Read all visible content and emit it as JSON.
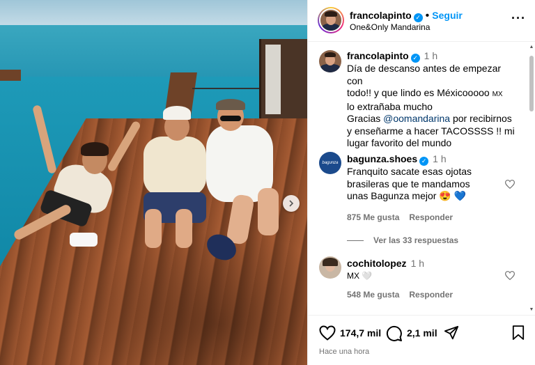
{
  "post": {
    "username": "francolapinto",
    "follow_label": "Seguir",
    "location": "One&Only Mandarina",
    "caption": {
      "username": "francolapinto",
      "time": "1 h",
      "line1": "Día de descanso antes de empezar con",
      "line2": "todo!! y que lindo es Méxicooooo",
      "line2_flag": "MX",
      "line3": "lo extrañaba mucho",
      "line4_prefix": "Gracias ",
      "line4_mention": "@oomandarina",
      "line4_suffix": " por recibirnos",
      "line5": "y enseñarme a hacer TACOSSSS !! mi",
      "line6": "lugar favorito del mundo"
    }
  },
  "comments": [
    {
      "username": "bagunza.shoes",
      "time": "1 h",
      "avatar_text": "bagunza",
      "line1": "Franquito sacate esas ojotas",
      "line2": "brasileras que te mandamos",
      "line3": "unas Bagunza mejor",
      "emoji": "😍 💙",
      "likes": "875 Me gusta",
      "reply": "Responder",
      "view_replies": "Ver las 33 respuestas"
    },
    {
      "username": "cochitolopez",
      "time": "1 h",
      "line1": "MX 🤍",
      "likes": "548 Me gusta",
      "reply": "Responder"
    }
  ],
  "actions": {
    "likes_count": "174,7 mil",
    "comments_count": "2,1 mil",
    "posted": "Hace una hora"
  },
  "icons": [
    "verified-icon",
    "more-icon",
    "heart-icon",
    "comment-icon",
    "share-icon",
    "save-icon",
    "next-arrow-icon"
  ]
}
